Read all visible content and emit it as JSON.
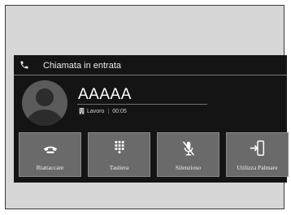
{
  "header": {
    "title": "Chiamata in entrata",
    "icon": "phone-icon"
  },
  "caller": {
    "name": "AAAAA",
    "label": "Lavoro",
    "duration": "00:05"
  },
  "buttons": [
    {
      "label": "Riattaccare",
      "icon": "hang-up-icon"
    },
    {
      "label": "Tastiera",
      "icon": "keypad-icon"
    },
    {
      "label": "Silenzioso",
      "icon": "mute-microphone-icon"
    },
    {
      "label": "Utilizza Palmare",
      "icon": "transfer-to-handset-icon"
    }
  ]
}
